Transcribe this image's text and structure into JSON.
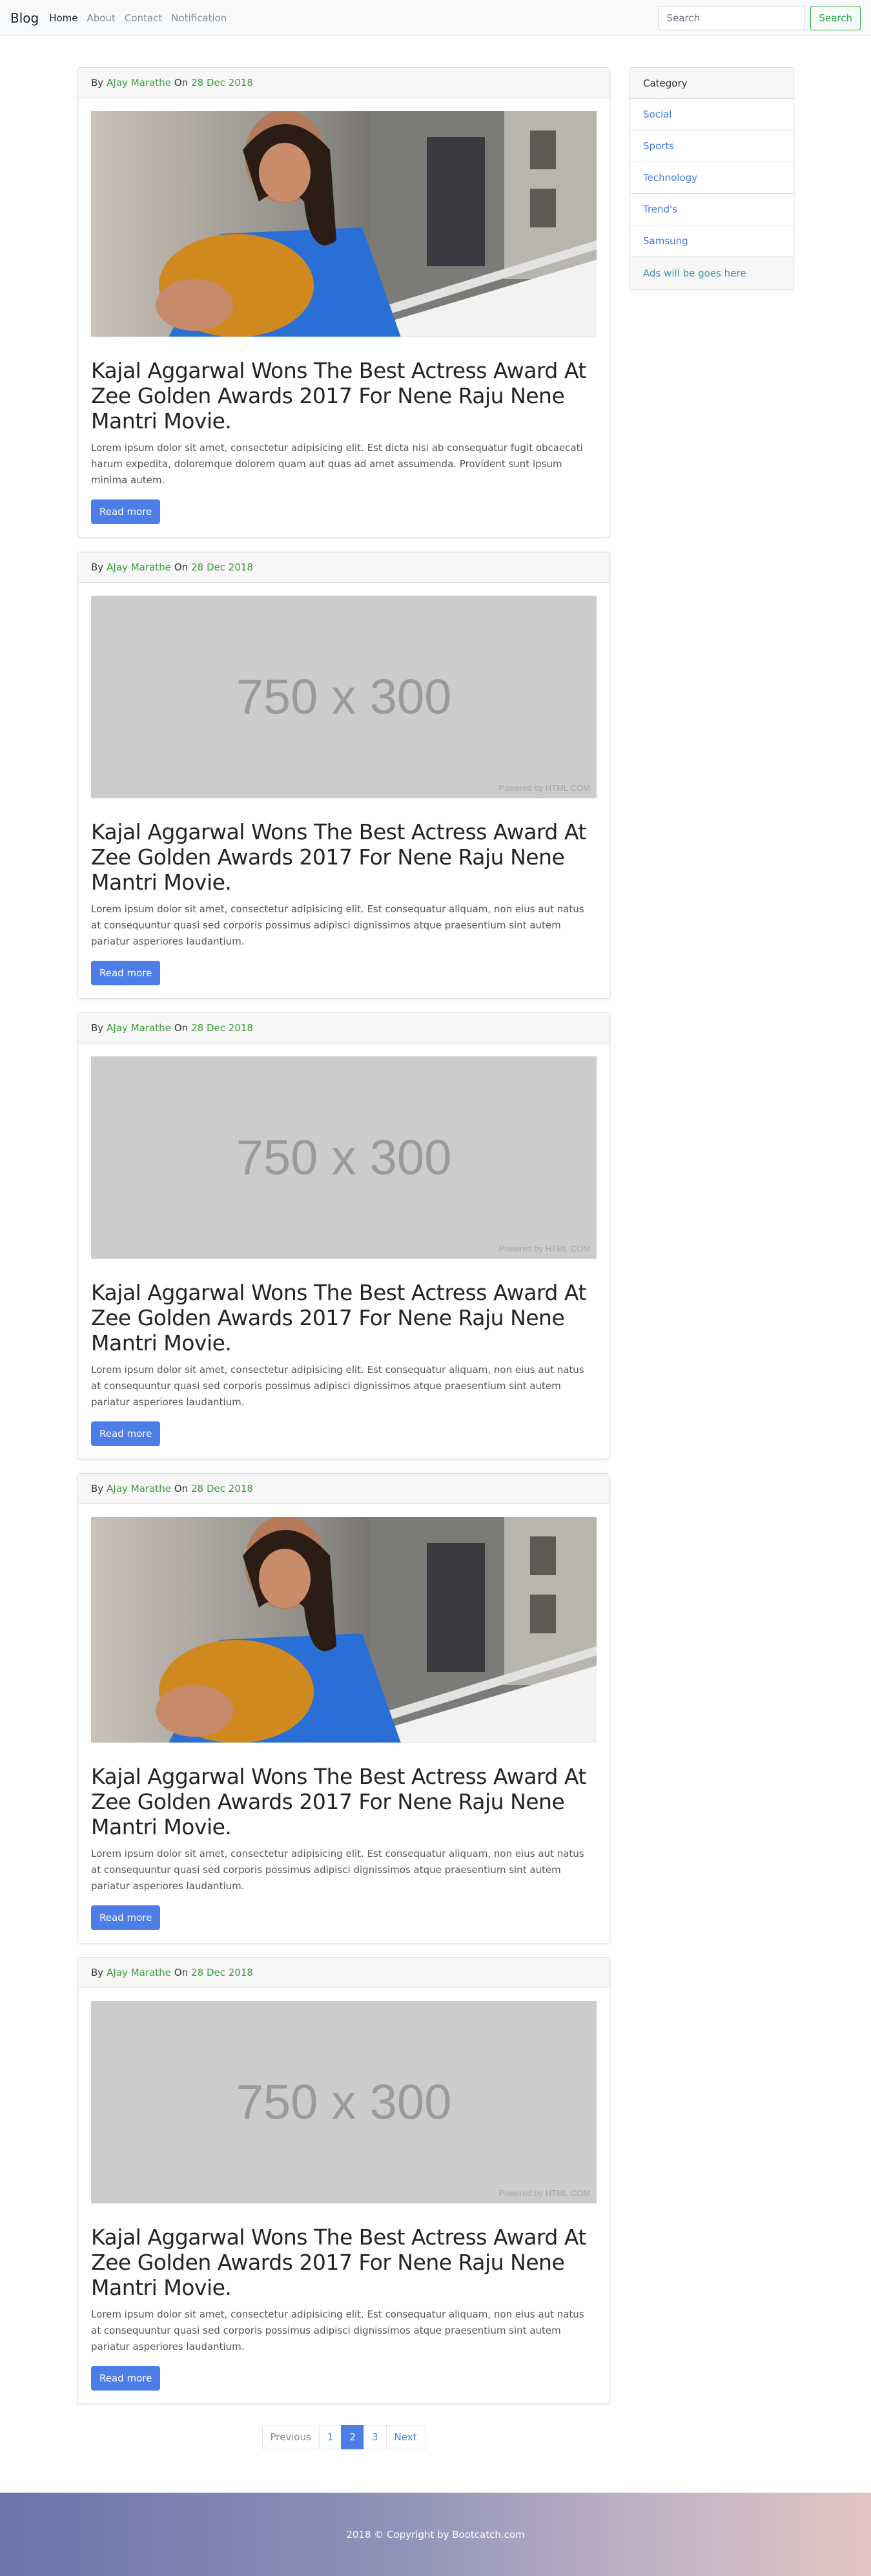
{
  "navbar": {
    "brand": "Blog",
    "links": [
      "Home",
      "About",
      "Contact",
      "Notification"
    ],
    "search_placeholder": "Search",
    "search_button": "Search"
  },
  "posts": [
    {
      "by_prefix": "By",
      "author": "AJay Marathe",
      "on_word": "On",
      "date": "28 Dec 2018",
      "image": "photo",
      "title": "Kajal Aggarwal Wons The Best Actress Award At Zee Golden Awards 2017 For Nene Raju Nene Mantri Movie.",
      "text": "Lorem ipsum dolor sit amet, consectetur adipisicing elit. Est dicta nisi ab consequatur fugit obcaecati harum expedita, doloremque dolorem quam aut quas ad amet assumenda. Provident sunt ipsum minima autem.",
      "button": "Read more"
    },
    {
      "by_prefix": "By",
      "author": "AJay Marathe",
      "on_word": "On",
      "date": "28 Dec 2018",
      "image": "placeholder",
      "placeholder_text": "750 x 300",
      "placeholder_credit": "Powered by HTML.COM",
      "title": "Kajal Aggarwal Wons The Best Actress Award At Zee Golden Awards 2017 For Nene Raju Nene Mantri Movie.",
      "text": "Lorem ipsum dolor sit amet, consectetur adipisicing elit. Est consequatur aliquam, non eius aut natus at consequuntur quasi sed corporis possimus adipisci dignissimos atque praesentium sint autem pariatur asperiores laudantium.",
      "button": "Read more"
    },
    {
      "by_prefix": "By",
      "author": "AJay Marathe",
      "on_word": "On",
      "date": "28 Dec 2018",
      "image": "placeholder",
      "placeholder_text": "750 x 300",
      "placeholder_credit": "Powered by HTML.COM",
      "title": "Kajal Aggarwal Wons The Best Actress Award At Zee Golden Awards 2017 For Nene Raju Nene Mantri Movie.",
      "text": "Lorem ipsum dolor sit amet, consectetur adipisicing elit. Est consequatur aliquam, non eius aut natus at consequuntur quasi sed corporis possimus adipisci dignissimos atque praesentium sint autem pariatur asperiores laudantium.",
      "button": "Read more"
    },
    {
      "by_prefix": "By",
      "author": "AJay Marathe",
      "on_word": "On",
      "date": "28 Dec 2018",
      "image": "photo",
      "title": "Kajal Aggarwal Wons The Best Actress Award At Zee Golden Awards 2017 For Nene Raju Nene Mantri Movie.",
      "text": "Lorem ipsum dolor sit amet, consectetur adipisicing elit. Est consequatur aliquam, non eius aut natus at consequuntur quasi sed corporis possimus adipisci dignissimos atque praesentium sint autem pariatur asperiores laudantium.",
      "button": "Read more"
    },
    {
      "by_prefix": "By",
      "author": "AJay Marathe",
      "on_word": "On",
      "date": "28 Dec 2018",
      "image": "placeholder",
      "placeholder_text": "750 x 300",
      "placeholder_credit": "Powered by HTML.COM",
      "title": "Kajal Aggarwal Wons The Best Actress Award At Zee Golden Awards 2017 For Nene Raju Nene Mantri Movie.",
      "text": "Lorem ipsum dolor sit amet, consectetur adipisicing elit. Est consequatur aliquam, non eius aut natus at consequuntur quasi sed corporis possimus adipisci dignissimos atque praesentium sint autem pariatur asperiores laudantium.",
      "button": "Read more"
    }
  ],
  "sidebar": {
    "header": "Category",
    "items": [
      "Social",
      "Sports",
      "Technology",
      "Trend's",
      "Samsung"
    ],
    "footer": "Ads will be goes here"
  },
  "pagination": {
    "previous": "Previous",
    "pages": [
      "1",
      "2",
      "3"
    ],
    "active_page": "2",
    "next": "Next"
  },
  "footer": {
    "text": "2018 © Copyright by Bootcatch.com"
  },
  "colors": {
    "accent": "#4d7ee8",
    "author_green": "#3c9a3c",
    "search_green": "#28a745"
  }
}
